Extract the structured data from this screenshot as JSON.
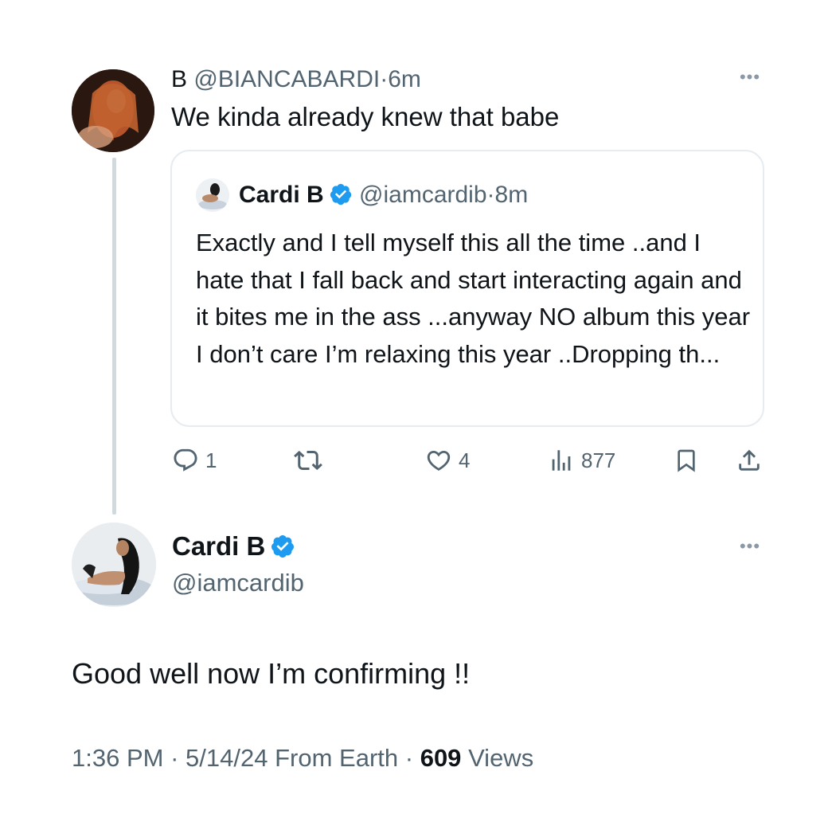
{
  "reply_tweet": {
    "author_name": "B",
    "author_handle": "@BIANCABARDI",
    "separator": "·",
    "time_ago": "6m",
    "text": "We kinda already knew that babe",
    "more_icon": "more-horizontal-icon"
  },
  "quoted_tweet": {
    "author_name": "Cardi B",
    "author_handle": "@iamcardib",
    "separator": "·",
    "time_ago": "8m",
    "verified_icon": "verified-badge-icon",
    "text": "Exactly and I tell myself this all the time ..and I hate that I fall back and start interacting again and it bites me in the ass ...anyway NO album this year I don’t care I’m relaxing this year ..Dropping th..."
  },
  "actions": {
    "reply_count": "1",
    "retweet_count": "",
    "like_count": "4",
    "views_count": "877"
  },
  "main_tweet": {
    "author_name": "Cardi B",
    "author_handle": "@iamcardib",
    "text": "Good well now I’m confirming !!",
    "time": "1:36 PM",
    "date": "5/14/24",
    "source": "From Earth",
    "views_count": "609",
    "views_label": "Views",
    "separator": "·"
  },
  "colors": {
    "accent_blue": "#1d9bf0",
    "text_primary": "#0f1419",
    "text_secondary": "#536471",
    "border": "#e6ecf0"
  }
}
